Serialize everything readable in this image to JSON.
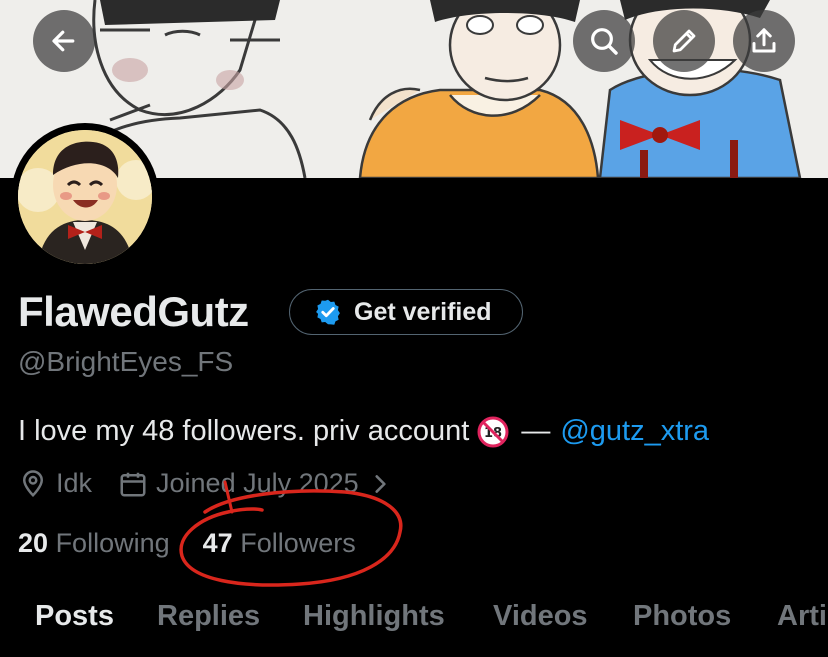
{
  "profile": {
    "display_name": "FlawedGutz",
    "handle": "@BrightEyes_FS",
    "get_verified_label": "Get verified",
    "bio_text": "I love my 48 followers. priv account",
    "bio_separator": "—",
    "bio_link": "@gutz_xtra",
    "location": "Idk",
    "joined": "Joined July 2025",
    "following_count": "20",
    "following_label": "Following",
    "followers_count": "47",
    "followers_label": "Followers"
  },
  "tabs": [
    {
      "label": "Posts",
      "active": true
    },
    {
      "label": "Replies",
      "active": false
    },
    {
      "label": "Highlights",
      "active": false
    },
    {
      "label": "Videos",
      "active": false
    },
    {
      "label": "Photos",
      "active": false
    },
    {
      "label": "Arti",
      "active": false
    }
  ],
  "header_actions": [
    "back-arrow-icon",
    "search-icon",
    "edit-pencil-icon",
    "share-upload-icon"
  ],
  "colors": {
    "background": "#000000",
    "text_primary": "#e7e9ea",
    "text_secondary": "#71767b",
    "link": "#1d9bf0",
    "verified_badge": "#1d9bf0",
    "annotation": "#d9261c"
  }
}
